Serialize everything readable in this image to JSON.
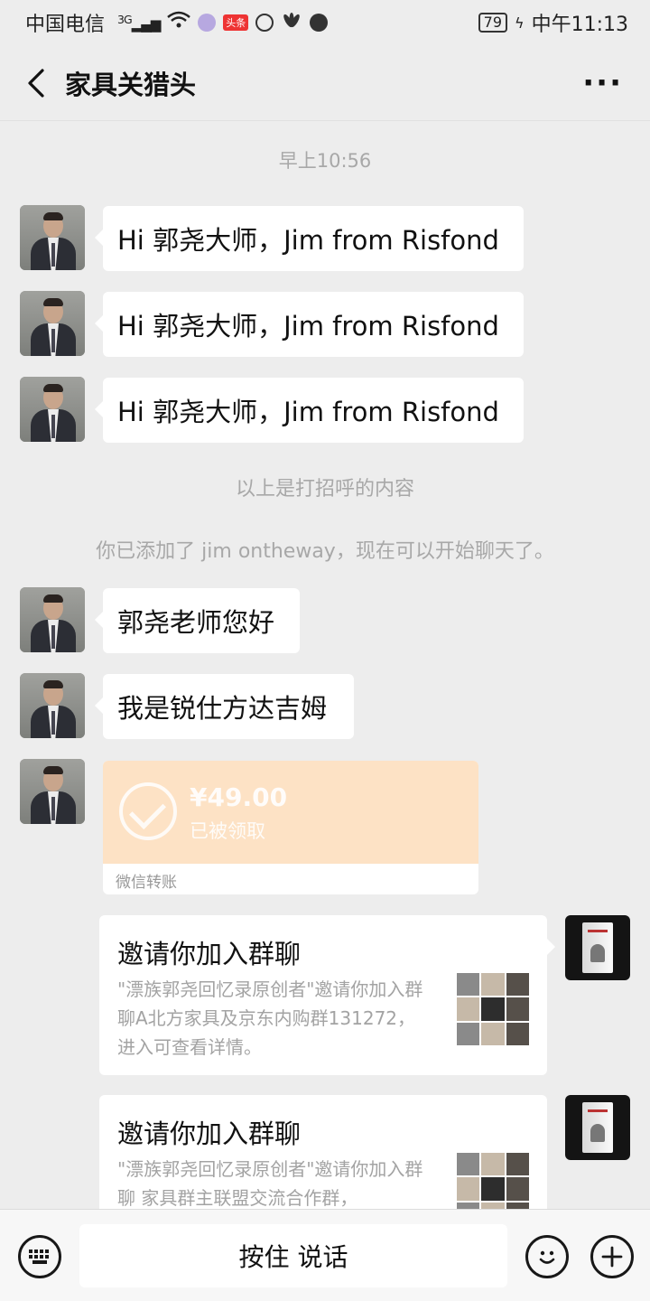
{
  "status_bar": {
    "carrier": "中国电信",
    "network": "3G",
    "badge": "头条",
    "battery": "79",
    "time": "中午11:13"
  },
  "header": {
    "title": "家具关猎头",
    "back_icon": "chevron-left-icon",
    "more_icon": "more-icon"
  },
  "chat": {
    "timestamp": "早上10:56",
    "greetings": [
      {
        "text": "Hi 郭尧大师，Jim from Risfond"
      },
      {
        "text": "Hi 郭尧大师，Jim from Risfond"
      },
      {
        "text": "Hi 郭尧大师，Jim from Risfond"
      }
    ],
    "system_note_1": "以上是打招呼的内容",
    "system_note_2": "你已添加了 jim ontheway，现在可以开始聊天了。",
    "messages": [
      {
        "text": "郭尧老师您好"
      },
      {
        "text": "我是锐仕方达吉姆"
      }
    ],
    "transfer": {
      "amount": "¥49.00",
      "status": "已被领取",
      "label": "微信转账"
    },
    "invites": [
      {
        "title": "邀请你加入群聊",
        "description": "\"漂族郭尧回忆录原创者\"邀请你加入群聊A北方家具及京东内购群131272，进入可查看详情。"
      },
      {
        "title": "邀请你加入群聊",
        "description": "\"漂族郭尧回忆录原创者\"邀请你加入群聊 家具群主联盟交流合作群，"
      }
    ]
  },
  "bottom_bar": {
    "voice_label": "按住 说话",
    "keyboard_icon": "keyboard-icon",
    "emoji_icon": "emoji-icon",
    "plus_icon": "plus-icon"
  }
}
